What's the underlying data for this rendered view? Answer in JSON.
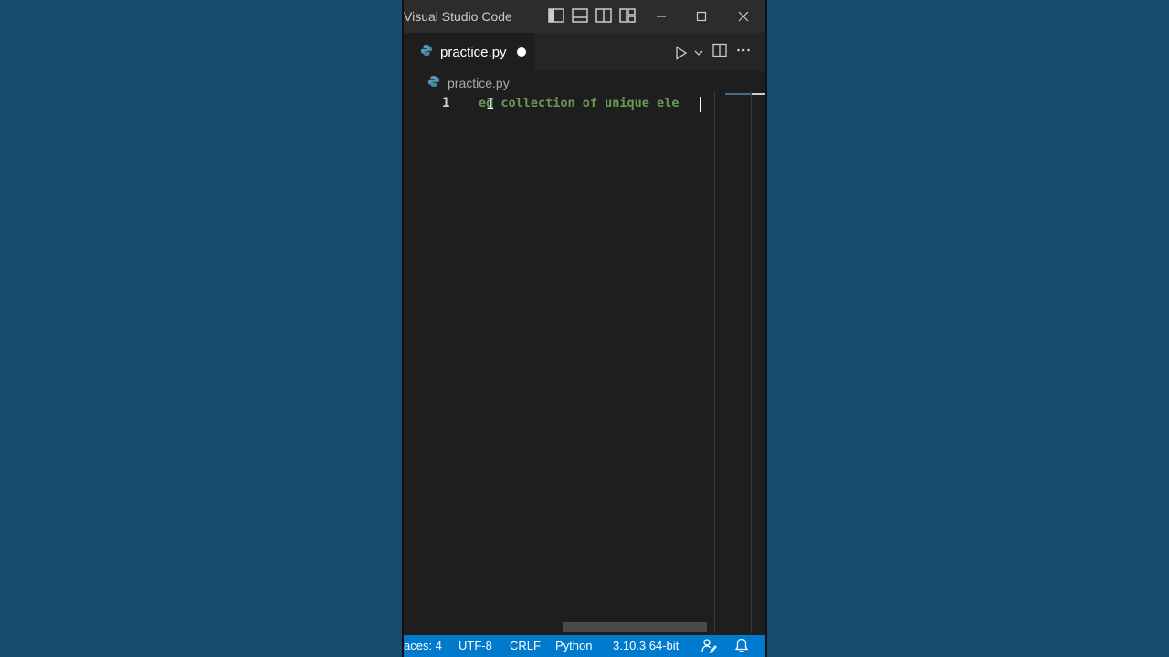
{
  "window": {
    "title": "Visual Studio Code"
  },
  "tab": {
    "label": "practice.py",
    "modified": true
  },
  "breadcrumb": {
    "file": "practice.py"
  },
  "editor": {
    "line_number": "1",
    "code_text": "ed collection of unique ele"
  },
  "statusbar": {
    "spaces": "aces: 4",
    "encoding": "UTF-8",
    "eol": "CRLF",
    "language": "Python",
    "interpreter": "3.10.3 64-bit"
  },
  "colors": {
    "background": "#174a6c",
    "editor_bg": "#1e1e1e",
    "comment_green": "#6a9955",
    "statusbar_blue": "#007acc"
  },
  "icons": {
    "python": "python-file-icon",
    "run": "run-play-icon",
    "split": "split-editor-icon",
    "more": "more-actions-icon",
    "feedback": "feedback-icon",
    "bell": "notifications-bell-icon"
  }
}
